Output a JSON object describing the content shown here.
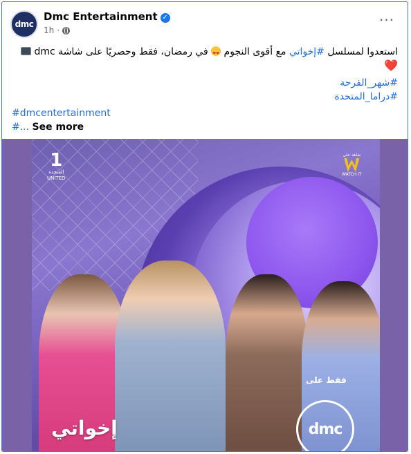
{
  "post": {
    "page_name": "Dmc Entertainment",
    "avatar_text": "dmc",
    "time": "1h",
    "separator": "·",
    "more_options": "···",
    "text_line1": "استعدوا لمسلسل #إخواتي مع أقوى النجوم 😍 في رمضان، فقط وحصريًا على شاشة dmc 📺",
    "text_line1_parts": {
      "before": "استعدوا لمسلسل ",
      "hashtag": "#إخواتي",
      "after1": " مع أقوى النجوم ",
      "after2": " في رمضان، فقط وحصريًا على شاشة dmc "
    },
    "heart": "❤️",
    "hashtags_ar": [
      "#شهر_الفرحة",
      "#دراما_المتحدة"
    ],
    "hashtag_en": "#dmcentertainment",
    "hashtag_truncated": "#...",
    "see_more": "See more"
  },
  "poster": {
    "united_logo": "1",
    "united_label_ar": "المتحدة",
    "united_label_en": "UNITED",
    "watchit_label_ar": "شاهد على",
    "watchit_label_en": "WATCH IT",
    "series_title": "إخواتي",
    "only_on": "فقط على",
    "dmc_logo": "dmc"
  },
  "colors": {
    "link": "#216fdb",
    "verified": "#1877f2",
    "poster_purple": "#7a62a8"
  }
}
